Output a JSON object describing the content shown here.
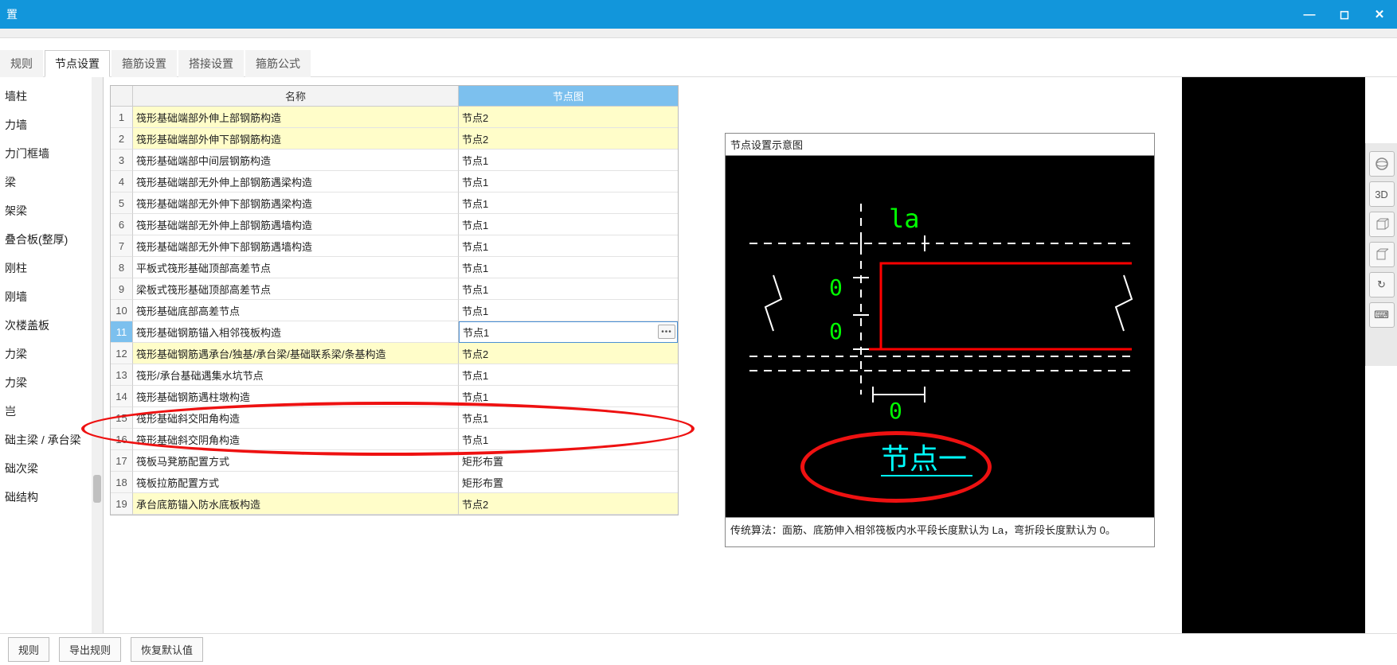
{
  "window": {
    "title_fragment": "置"
  },
  "tabs": {
    "t1": "规则",
    "t2": "节点设置",
    "t3": "箍筋设置",
    "t4": "搭接设置",
    "t5": "箍筋公式"
  },
  "sidebar": {
    "items": [
      "墙柱",
      "力墙",
      "力门框墙",
      "梁",
      "架梁",
      "叠合板(整厚)",
      "刚柱",
      "刚墙",
      "次楼盖板",
      "力梁",
      "力梁",
      "岂",
      "础主梁 / 承台梁",
      "础次梁",
      "础结构"
    ]
  },
  "grid": {
    "col_name": "名称",
    "col_node": "节点图",
    "rows": [
      {
        "n": "1",
        "name": "筏形基础端部外伸上部钢筋构造",
        "node": "节点2",
        "hl": true
      },
      {
        "n": "2",
        "name": "筏形基础端部外伸下部钢筋构造",
        "node": "节点2",
        "hl": true
      },
      {
        "n": "3",
        "name": "筏形基础端部中间层钢筋构造",
        "node": "节点1",
        "hl": false
      },
      {
        "n": "4",
        "name": "筏形基础端部无外伸上部钢筋遇梁构造",
        "node": "节点1",
        "hl": false
      },
      {
        "n": "5",
        "name": "筏形基础端部无外伸下部钢筋遇梁构造",
        "node": "节点1",
        "hl": false
      },
      {
        "n": "6",
        "name": "筏形基础端部无外伸上部钢筋遇墙构造",
        "node": "节点1",
        "hl": false
      },
      {
        "n": "7",
        "name": "筏形基础端部无外伸下部钢筋遇墙构造",
        "node": "节点1",
        "hl": false
      },
      {
        "n": "8",
        "name": "平板式筏形基础顶部高差节点",
        "node": "节点1",
        "hl": false
      },
      {
        "n": "9",
        "name": "梁板式筏形基础顶部高差节点",
        "node": "节点1",
        "hl": false
      },
      {
        "n": "10",
        "name": "筏形基础底部高差节点",
        "node": "节点1",
        "hl": false
      },
      {
        "n": "11",
        "name": "筏形基础钢筋锚入相邻筏板构造",
        "node": "节点1",
        "hl": false,
        "sel": true
      },
      {
        "n": "12",
        "name": "筏形基础钢筋遇承台/独基/承台梁/基础联系梁/条基构造",
        "node": "节点2",
        "hl": true
      },
      {
        "n": "13",
        "name": "筏形/承台基础遇集水坑节点",
        "node": "节点1",
        "hl": false
      },
      {
        "n": "14",
        "name": "筏形基础钢筋遇柱墩构造",
        "node": "节点1",
        "hl": false
      },
      {
        "n": "15",
        "name": "筏形基础斜交阳角构造",
        "node": "节点1",
        "hl": false
      },
      {
        "n": "16",
        "name": "筏形基础斜交阴角构造",
        "node": "节点1",
        "hl": false
      },
      {
        "n": "17",
        "name": "筏板马凳筋配置方式",
        "node": "矩形布置",
        "hl": false
      },
      {
        "n": "18",
        "name": "筏板拉筋配置方式",
        "node": "矩形布置",
        "hl": false
      },
      {
        "n": "19",
        "name": "承台底筋锚入防水底板构造",
        "node": "节点2",
        "hl": true
      }
    ]
  },
  "diagram": {
    "title": "节点设置示意图",
    "la": "la",
    "zero": "0",
    "caption": "节点一",
    "desc": "传统算法：面筋、底筋伸入相邻筏板内水平段长度默认为 La，弯折段长度默认为 0。"
  },
  "footer": {
    "b1": "规则",
    "b2": "导出规则",
    "b3": "恢复默认值"
  },
  "right_toolbar": {
    "i1": "",
    "i2": "3D",
    "i3": "",
    "i4": "",
    "i5": "↻",
    "i6": "⌨"
  }
}
